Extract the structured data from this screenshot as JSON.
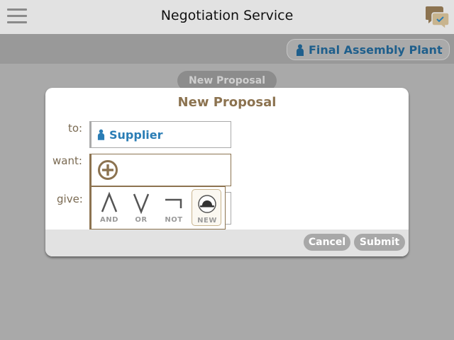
{
  "header": {
    "title": "Negotiation Service",
    "menu_icon": "hamburger-menu-icon",
    "chat_icon": "chat-bubbles-icon"
  },
  "org": {
    "name": "Final Assembly Plant",
    "icon": "person-icon"
  },
  "background_button": {
    "label": "New Proposal"
  },
  "dialog": {
    "title": "New Proposal",
    "to_label": "to:",
    "to_value": "Supplier",
    "want_label": "want:",
    "give_label": "give:",
    "add_icon": "plus-circle-icon",
    "operators": [
      {
        "label": "AND",
        "symbol": "∧"
      },
      {
        "label": "OR",
        "symbol": "∨"
      },
      {
        "label": "NOT",
        "symbol": "¬"
      },
      {
        "label": "NEW",
        "icon": "bowler-hat-icon"
      }
    ],
    "cancel_label": "Cancel",
    "submit_label": "Submit"
  },
  "colors": {
    "accent_brown": "#8c7350",
    "link_blue": "#2a7db5",
    "overlay_gray": "#a9a9a9"
  }
}
